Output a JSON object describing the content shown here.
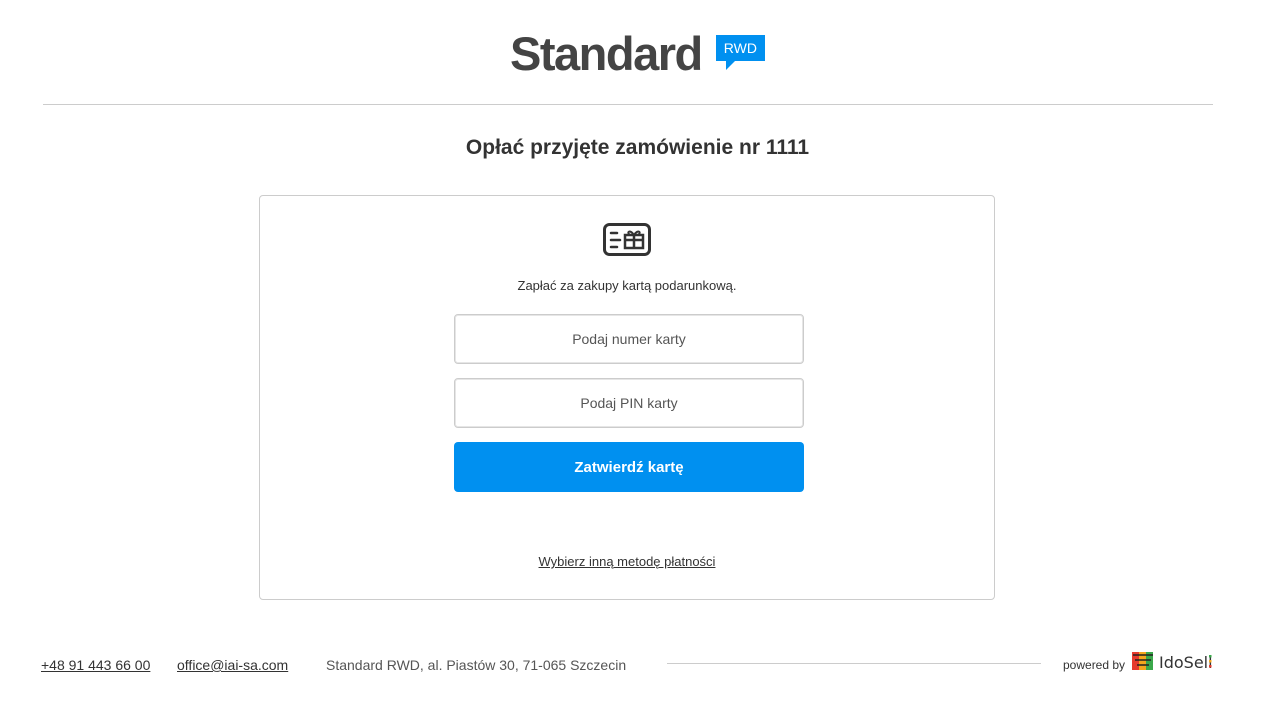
{
  "header": {
    "logo_text": "Standard",
    "logo_badge": "RWD"
  },
  "page": {
    "title": "Opłać przyjęte zamówienie nr 1111"
  },
  "payment_card": {
    "icon": "gift-card-icon",
    "description": "Zapłać za zakupy kartą podarunkową.",
    "card_number_placeholder": "Podaj numer karty",
    "card_number_value": "",
    "pin_placeholder": "Podaj PIN karty",
    "pin_value": "",
    "submit_label": "Zatwierdź kartę",
    "other_method_link": "Wybierz inną metodę płatności"
  },
  "footer": {
    "phone": "+48 91 443 66 00",
    "email": "office@iai-sa.com",
    "address": "Standard RWD, al. Piastów 30, 71-065 Szczecin",
    "powered_by": "powered by",
    "brand": "IdoSell"
  },
  "colors": {
    "accent": "#0090f0",
    "border": "#cccccc",
    "text": "#333333"
  }
}
